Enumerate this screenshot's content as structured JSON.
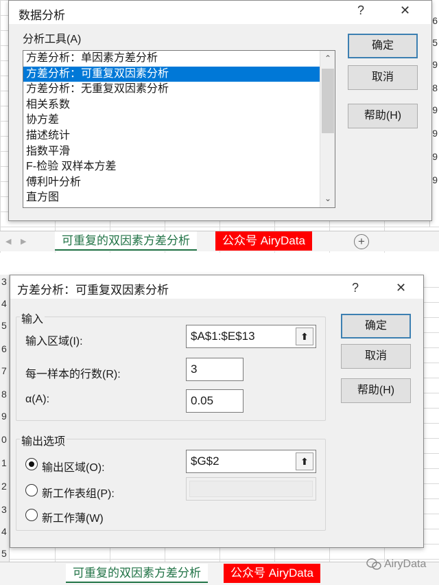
{
  "dialog1": {
    "title": "数据分析",
    "help_glyph": "?",
    "close_glyph": "✕",
    "tools_label": "分析工具(A)",
    "tools": [
      "方差分析：单因素方差分析",
      "方差分析：可重复双因素分析",
      "方差分析：无重复双因素分析",
      "相关系数",
      "协方差",
      "描述统计",
      "指数平滑",
      "F-检验 双样本方差",
      "傅利叶分析",
      "直方图"
    ],
    "selected_index": 1,
    "scroll_up": "⌃",
    "scroll_down": "⌄",
    "ok": "确定",
    "cancel": "取消",
    "help": "帮助(H)"
  },
  "sheet_tabs_1": {
    "active": "可重复的双因素方差分析",
    "other": "公众号 AiryData",
    "add": "+",
    "nav_prev": "◀",
    "nav_next": "▶"
  },
  "edge_digits_1": [
    "6",
    "5",
    "9",
    "8",
    "9",
    "9",
    "9",
    "9"
  ],
  "row_nums_2": [
    "3",
    "4",
    "5",
    "6",
    "7",
    "8",
    "9",
    "0",
    "1",
    "2",
    "3",
    "4",
    "5"
  ],
  "dialog2": {
    "title": "方差分析：可重复双因素分析",
    "help_glyph": "?",
    "close_glyph": "✕",
    "input_group": "输入",
    "input_range_label": "输入区域(I):",
    "input_range_value": "$A$1:$E$13",
    "rows_label": "每一样本的行数(R):",
    "rows_value": "3",
    "alpha_label": "α(A):",
    "alpha_value": "0.05",
    "output_group": "输出选项",
    "output_range_label": "输出区域(O):",
    "output_range_value": "$G$2",
    "new_sheet_label": "新工作表组(P):",
    "new_workbook_label": "新工作薄(W)",
    "ref_glyph": "⬆",
    "ok": "确定",
    "cancel": "取消",
    "help": "帮助(H)"
  },
  "sheet_tabs_2": {
    "active": "可重复的双因素方差分析",
    "other": "公众号 AiryData",
    "add": "+"
  },
  "watermark": {
    "text": "AiryData",
    "icon": "wechat-icon"
  }
}
